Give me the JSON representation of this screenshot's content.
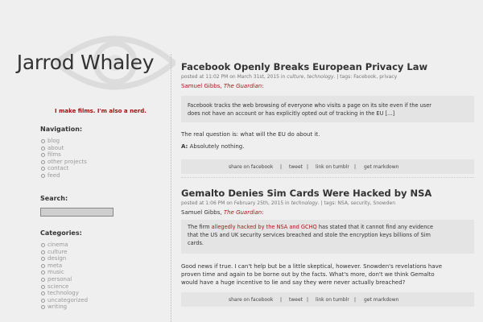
{
  "site": {
    "title": "Jarrod Whaley",
    "tagline": "I make films. I'm also a nerd."
  },
  "sidebar": {
    "navigation_heading": "Navigation:",
    "nav_items": [
      "blog",
      "about",
      "films",
      "other projects",
      "contact",
      "feed"
    ],
    "search_heading": "Search:",
    "search_value": "",
    "categories_heading": "Categories:",
    "categories": [
      "cinema",
      "culture",
      "design",
      "meta",
      "music",
      "personal",
      "science",
      "technology",
      "uncategorized",
      "writing"
    ]
  },
  "posts": [
    {
      "title": "Facebook Openly Breaks European Privacy Law",
      "meta_posted": "posted at 11:02 PM on March 31st, 2015 in",
      "meta_cat1": "culture",
      "meta_cat2": "technology",
      "meta_tags_label": ". | tags:",
      "meta_tags": "Facebook, privacy",
      "source_author": "Samuel Gibbs,",
      "source_pub": "The Guardian",
      "source_colon": ":",
      "quote_line1": "Facebook tracks the web browsing of everyone who visits a page on its site even if the user",
      "quote_line2": "does not have an account or has explicitly opted out of tracking in the EU […]",
      "para1": "The real question is: what will the EU do about it.",
      "para2_bold": "A:",
      "para2_rest": "Absolutely nothing."
    },
    {
      "title": "Gemalto Denies Sim Cards Were Hacked by NSA",
      "meta_posted": "posted at 1:06 PM on February 25th, 2015 in",
      "meta_cat1": "technology",
      "meta_tags_label": ". | tags:",
      "meta_tags": "NSA, security, Snowden",
      "source_author": "Samuel Gibbs,",
      "source_pub": "The Guardian",
      "source_colon": ":",
      "quote_pre": "The firm",
      "quote_link": "allegedly hacked by the NSA and GCHQ",
      "quote_post": "has stated that it cannot find any evidence",
      "quote_line2": "that the US and UK security services breached and stole the encryption keys billions of Sim",
      "quote_line3": "cards.",
      "para1_line1": "Good news if true. I can't help but be a little skeptical, however. Snowden's revelations have",
      "para1_line2": "proven time and again to be borne out by the facts. What's more, don't we think Gemalto",
      "para1_line3": "would have a huge incentive to lie and say they were never actually breached?"
    }
  ],
  "actions": {
    "share_facebook": "share on facebook",
    "tweet": "tweet",
    "link_tumblr": "link on tumblr",
    "get_markdown": "get markdown",
    "separator": "|"
  }
}
